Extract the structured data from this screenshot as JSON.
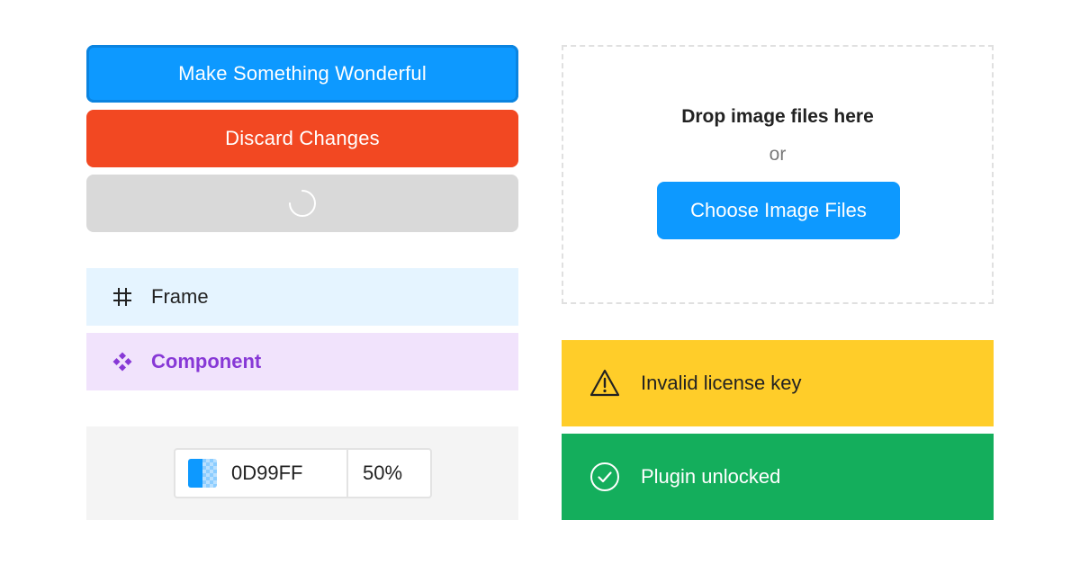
{
  "buttons": {
    "primary_label": "Make Something Wonderful",
    "danger_label": "Discard Changes",
    "loading_state": "loading-spinner"
  },
  "layers": {
    "frame_label": "Frame",
    "frame_icon": "hash-frame-icon",
    "component_label": "Component",
    "component_icon": "component-diamond-icon"
  },
  "color_input": {
    "hex": "0D99FF",
    "opacity": "50%",
    "swatch_color": "#0D99FF"
  },
  "dropzone": {
    "title": "Drop image files here",
    "or_text": "or",
    "button_label": "Choose Image Files"
  },
  "banners": {
    "warning_text": "Invalid license key",
    "warning_icon": "warning-triangle-icon",
    "warning_color": "#FFCD29",
    "success_text": "Plugin unlocked",
    "success_icon": "check-circle-icon",
    "success_color": "#14AE5C"
  },
  "colors": {
    "primary": "#0D99FF",
    "danger": "#F24822",
    "disabled": "#D9D9D9",
    "component": "#8738D6"
  }
}
